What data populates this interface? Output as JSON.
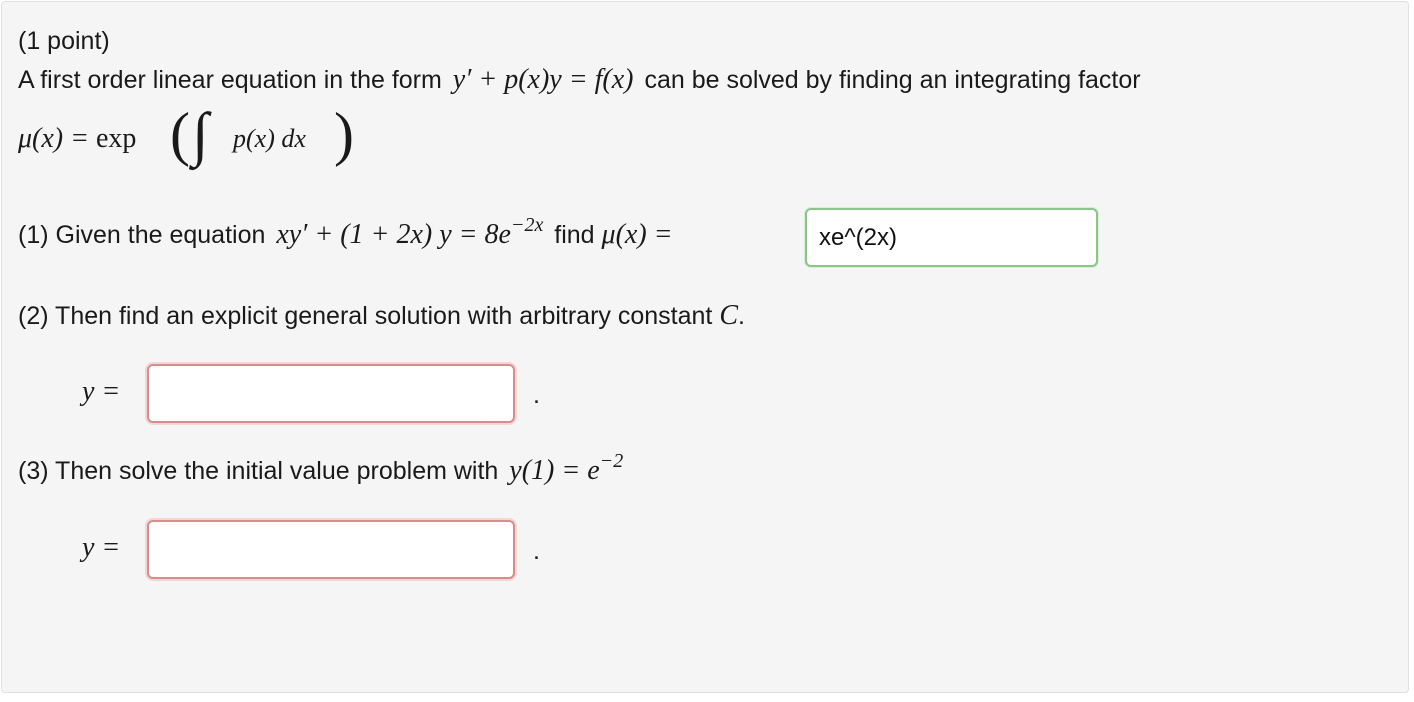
{
  "header": {
    "points": "(1 point)"
  },
  "intro": {
    "text_before": "A first order linear equation in the form",
    "form_math": "y′ + p(x)y = f(x)",
    "text_after": "can be solved by finding an integrating factor",
    "mu_lhs": "μ(x) =",
    "mu_exp": "exp",
    "mu_integrand": "p(x) dx"
  },
  "q1": {
    "prefix": "(1) Given the equation",
    "equation": "xy′ + (1 + 2x) y = 8e",
    "exponent": "−2x",
    "find_text": "find",
    "mu_label": "μ(x) =",
    "answer": "xe^(2x)",
    "status": "correct"
  },
  "q2": {
    "prefix": "(2) Then find an explicit general solution with arbitrary constant",
    "constant": "C",
    "period": ".",
    "y_label": "y =",
    "answer": "",
    "trailing": ".",
    "status": "incorrect"
  },
  "q3": {
    "prefix": "(3) Then solve the initial value problem with",
    "condition": "y(1) = e",
    "exponent": "−2",
    "y_label": "y =",
    "answer": "",
    "trailing": ".",
    "status": "incorrect"
  },
  "colors": {
    "correct_border": "#8dc48b",
    "incorrect_border": "#d98c8c",
    "panel_bg": "#f5f5f5"
  }
}
